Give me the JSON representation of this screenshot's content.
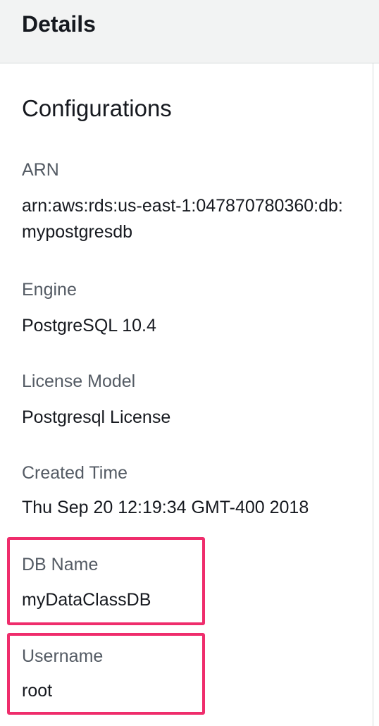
{
  "header": {
    "title": "Details"
  },
  "section": {
    "title": "Configurations"
  },
  "fields": {
    "arn": {
      "label": "ARN",
      "value": "arn:aws:rds:us-east-1:047870780360:db:mypostgresdb"
    },
    "engine": {
      "label": "Engine",
      "value": "PostgreSQL 10.4"
    },
    "license_model": {
      "label": "License Model",
      "value": "Postgresql License"
    },
    "created_time": {
      "label": "Created Time",
      "value": "Thu Sep 20 12:19:34 GMT-400 2018"
    },
    "db_name": {
      "label": "DB Name",
      "value": "myDataClassDB"
    },
    "username": {
      "label": "Username",
      "value": "root"
    }
  },
  "colors": {
    "highlight": "#ef2d6c",
    "header_bg": "#f2f3f3",
    "label": "#545b64",
    "value": "#16191f"
  }
}
